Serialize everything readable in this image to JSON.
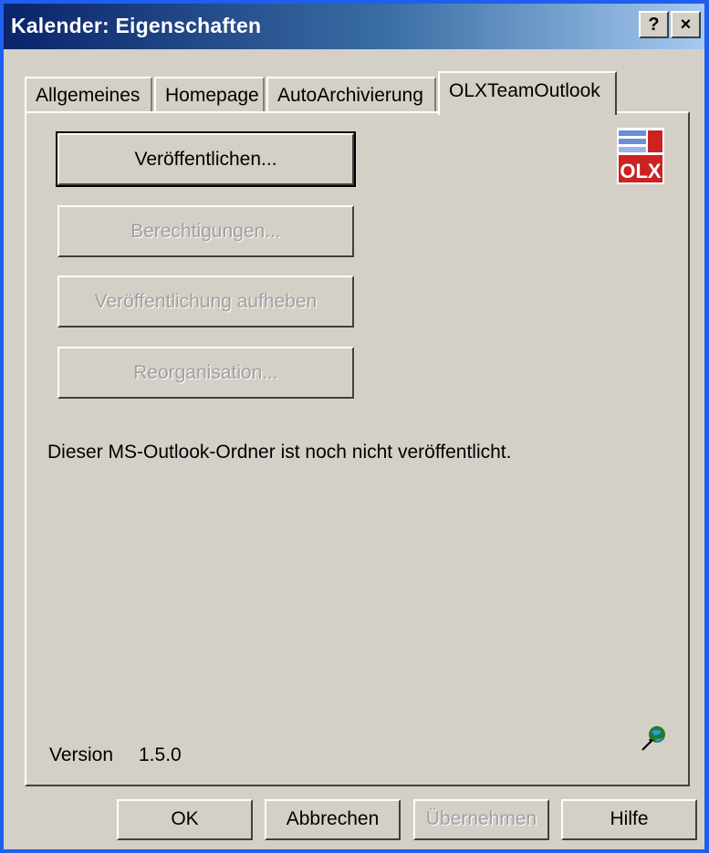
{
  "window": {
    "title": "Kalender: Eigenschaften",
    "help_button": "?",
    "close_button": "×"
  },
  "tabs": [
    {
      "label": "Allgemeines"
    },
    {
      "label": "Homepage"
    },
    {
      "label": "AutoArchivierung"
    },
    {
      "label": "OLXTeamOutlook"
    }
  ],
  "panel": {
    "buttons": {
      "publish": "Veröffentlichen...",
      "permissions": "Berechtigungen...",
      "unpublish": "Veröffentlichung aufheben",
      "reorganize": "Reorganisation..."
    },
    "status_text": "Dieser MS-Outlook-Ordner ist noch nicht veröffentlicht.",
    "version_label": "Version",
    "version_value": "1.5.0",
    "logo_text": "OLX",
    "icons": {
      "logo": "olx-logo-icon",
      "globe": "globe-network-icon"
    }
  },
  "footer": {
    "ok": "OK",
    "cancel": "Abbrechen",
    "apply": "Übernehmen",
    "help": "Hilfe"
  },
  "colors": {
    "titlebar_start": "#0a246a",
    "titlebar_end": "#a6caf0",
    "face": "#d4d0c8",
    "disabled_text": "#a0a0a0"
  }
}
